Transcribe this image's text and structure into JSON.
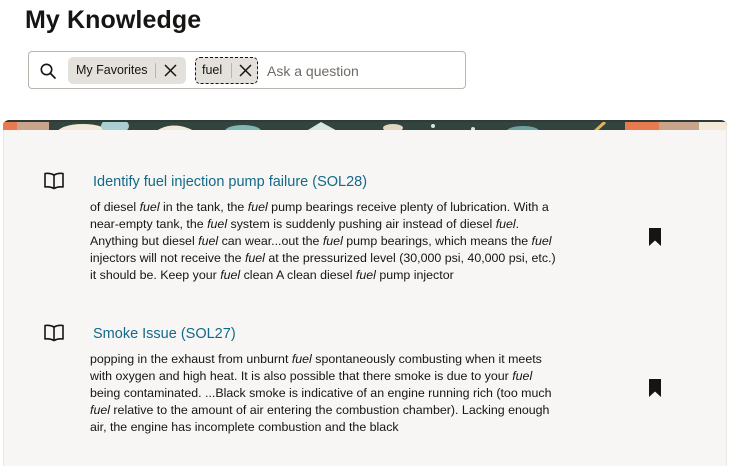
{
  "page": {
    "title": "My Knowledge"
  },
  "search": {
    "chips": [
      {
        "label": "My Favorites"
      },
      {
        "label": "fuel"
      }
    ],
    "placeholder": "Ask a question"
  },
  "results": [
    {
      "title": "Identify fuel injection pump failure (SOL28)",
      "snippet": [
        {
          "t": "of diesel "
        },
        {
          "t": "fuel",
          "em": true
        },
        {
          "t": " in the tank, the "
        },
        {
          "t": "fuel",
          "em": true
        },
        {
          "t": " pump bearings receive plenty of lubrication. With a near-empty tank, the "
        },
        {
          "t": "fuel",
          "em": true
        },
        {
          "t": " system is suddenly pushing air instead of diesel "
        },
        {
          "t": "fuel",
          "em": true
        },
        {
          "t": ". Anything but diesel "
        },
        {
          "t": "fuel",
          "em": true
        },
        {
          "t": " can wear...out the "
        },
        {
          "t": "fuel",
          "em": true
        },
        {
          "t": " pump bearings, which means the "
        },
        {
          "t": "fuel",
          "em": true
        },
        {
          "t": " injectors will not receive the "
        },
        {
          "t": "fuel",
          "em": true
        },
        {
          "t": " at the pressurized level (30,000 psi, 40,000 psi, etc.) it should be. Keep your "
        },
        {
          "t": "fuel",
          "em": true
        },
        {
          "t": " clean A clean diesel "
        },
        {
          "t": "fuel",
          "em": true
        },
        {
          "t": " pump injector"
        }
      ],
      "icon": "book-open-icon",
      "bookmark_icon": "bookmark-filled-icon"
    },
    {
      "title": "Smoke Issue (SOL27)",
      "snippet": [
        {
          "t": "popping in the exhaust from unburnt "
        },
        {
          "t": "fuel",
          "em": true
        },
        {
          "t": " spontaneously combusting when it meets with oxygen and high heat.   It is also possible that there smoke is due to your "
        },
        {
          "t": "fuel",
          "em": true
        },
        {
          "t": " being contaminated. ...Black smoke is indicative of an engine running rich (too much "
        },
        {
          "t": "fuel",
          "em": true
        },
        {
          "t": " relative to the amount of air entering the combustion chamber). Lacking enough air, the engine has incomplete combustion and the black"
        }
      ],
      "icon": "book-open-icon",
      "bookmark_icon": "bookmark-filled-icon"
    }
  ],
  "colors": {
    "link": "#136989",
    "chip_bg": "#e4e1dc",
    "panel_bg": "#f7f6f4"
  }
}
